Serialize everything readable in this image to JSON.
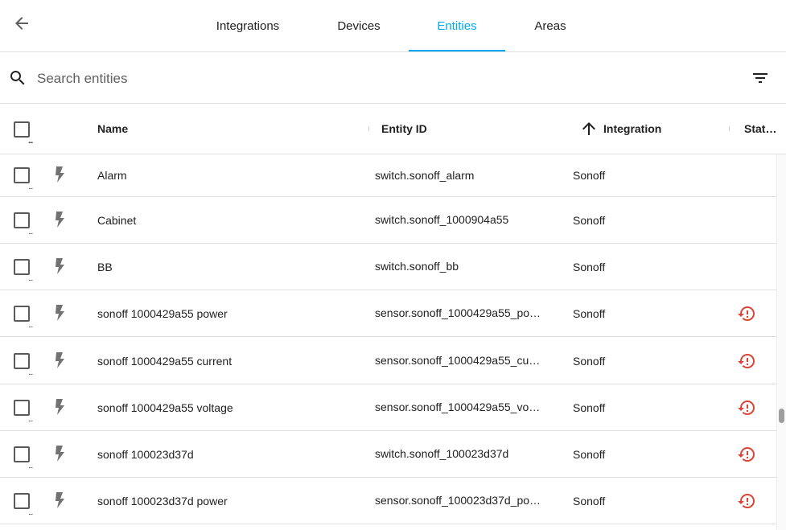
{
  "colors": {
    "accent": "#03a9f4",
    "error": "#db4437",
    "icon": "#727272"
  },
  "icons": {
    "back": "arrow-left-icon",
    "search": "magnify-icon",
    "filter": "filter-variant-icon",
    "row": "flash-icon",
    "sort": "arrow-up-icon",
    "status": "restore-alert-icon"
  },
  "tabs": [
    {
      "label": "Integrations",
      "active": false
    },
    {
      "label": "Devices",
      "active": false
    },
    {
      "label": "Entities",
      "active": true
    },
    {
      "label": "Areas",
      "active": false
    }
  ],
  "search": {
    "placeholder": "Search entities",
    "value": ""
  },
  "table": {
    "headers": {
      "name": "Name",
      "entity_id": "Entity ID",
      "integration": "Integration",
      "status": "Stat…"
    },
    "sort": {
      "column": "Integration",
      "direction": "ascending"
    },
    "rows": [
      {
        "name": "Alarm",
        "entity_id": "switch.sonoff_alarm",
        "integration": "Sonoff",
        "status_alert": false
      },
      {
        "name": "Cabinet",
        "entity_id": "switch.sonoff_1000904a55",
        "integration": "Sonoff",
        "status_alert": false
      },
      {
        "name": "BB",
        "entity_id": "switch.sonoff_bb",
        "integration": "Sonoff",
        "status_alert": false
      },
      {
        "name": "sonoff 1000429a55 power",
        "entity_id": "sensor.sonoff_1000429a55_po…",
        "integration": "Sonoff",
        "status_alert": true
      },
      {
        "name": "sonoff 1000429a55 current",
        "entity_id": "sensor.sonoff_1000429a55_cu…",
        "integration": "Sonoff",
        "status_alert": true
      },
      {
        "name": "sonoff 1000429a55 voltage",
        "entity_id": "sensor.sonoff_1000429a55_vo…",
        "integration": "Sonoff",
        "status_alert": true
      },
      {
        "name": "sonoff 100023d37d",
        "entity_id": "switch.sonoff_100023d37d",
        "integration": "Sonoff",
        "status_alert": true
      },
      {
        "name": "sonoff 100023d37d power",
        "entity_id": "sensor.sonoff_100023d37d_po…",
        "integration": "Sonoff",
        "status_alert": true
      }
    ]
  }
}
